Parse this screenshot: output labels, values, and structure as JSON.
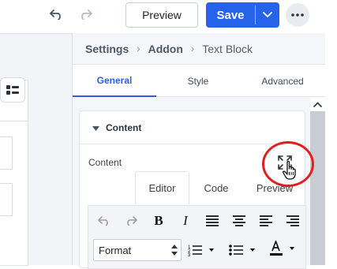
{
  "toolbar": {
    "preview_label": "Preview",
    "save_label": "Save"
  },
  "breadcrumb": [
    "Settings",
    "Addon",
    "Text Block"
  ],
  "tabs": [
    {
      "label": "General",
      "active": true
    },
    {
      "label": "Style",
      "active": false
    },
    {
      "label": "Advanced",
      "active": false
    }
  ],
  "section": {
    "title": "Content",
    "field_label": "Content"
  },
  "editor_tabs": [
    {
      "label": "Editor",
      "active": true
    },
    {
      "label": "Code",
      "active": false
    },
    {
      "label": "Preview",
      "active": false
    }
  ],
  "editor_toolbar": {
    "buttons": [
      "undo-icon",
      "redo-icon",
      "bold-icon",
      "italic-icon",
      "justify-icon",
      "align-center-icon",
      "align-left-icon",
      "align-right-icon",
      "numbered-list-icon",
      "bulleted-list-icon",
      "text-color-icon"
    ],
    "format_value": "Format",
    "text_color": "#000000"
  },
  "colors": {
    "accent": "#2563eb",
    "tab_active": "#2f5fd7",
    "highlight_ring": "#e02020"
  }
}
